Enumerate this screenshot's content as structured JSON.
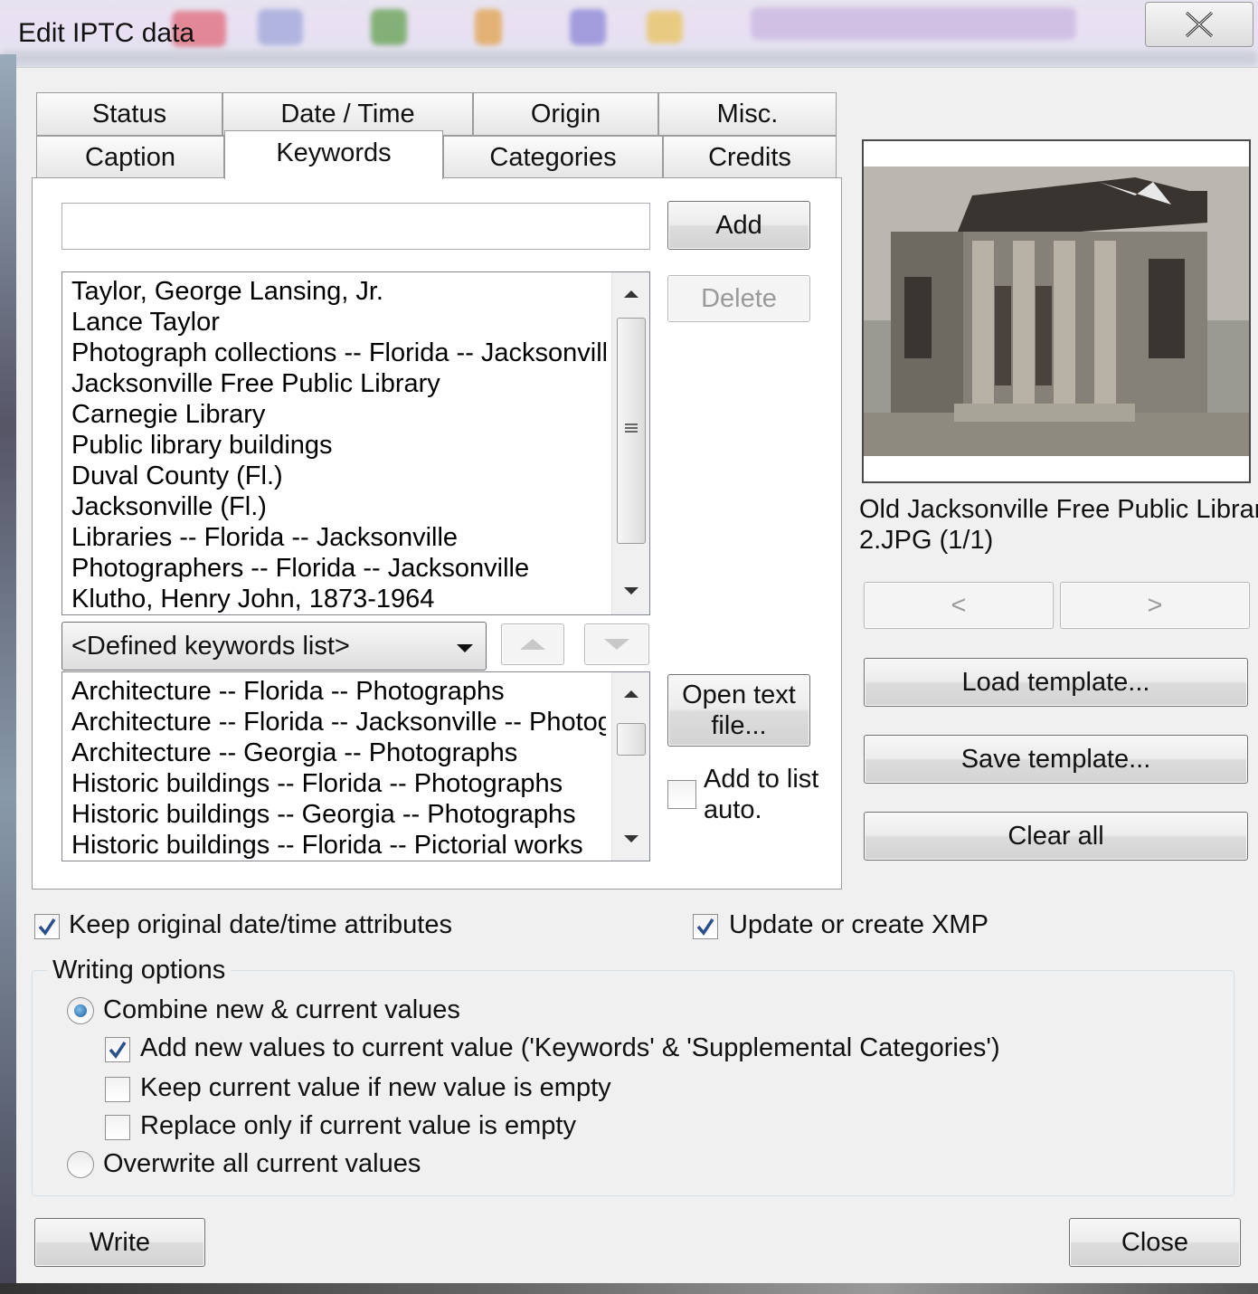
{
  "window": {
    "title": "Edit IPTC data",
    "background_path_hint": "Z:\\Lance Taylor\\Libraries\\"
  },
  "tabs": {
    "row1": [
      "Status",
      "Date / Time",
      "Origin",
      "Misc."
    ],
    "row2": [
      "Caption",
      "Keywords",
      "Categories",
      "Credits"
    ],
    "active": "Keywords"
  },
  "keywords": {
    "input_value": "",
    "add_label": "Add",
    "delete_label": "Delete",
    "items": [
      "Taylor, George Lansing, Jr.",
      "Lance Taylor",
      "Photograph collections -- Florida -- Jacksonville",
      "Jacksonville Free Public Library",
      "Carnegie Library",
      "Public library buildings",
      "Duval County (Fl.)",
      "Jacksonville (Fl.)",
      "Libraries -- Florida -- Jacksonville",
      "Photographers -- Florida -- Jacksonville",
      "Klutho, Henry John, 1873-1964"
    ],
    "defined_list_selected": "<Defined keywords list>",
    "defined_items": [
      "Architecture -- Florida -- Photographs",
      "Architecture -- Florida -- Jacksonville -- Photographs",
      "Architecture -- Georgia -- Photographs",
      "Historic buildings -- Florida -- Photographs",
      "Historic buildings -- Georgia -- Photographs",
      "Historic buildings -- Florida -- Pictorial works"
    ],
    "open_text_file_line1": "Open text",
    "open_text_file_line2": "file...",
    "add_to_list_line1": "Add to list",
    "add_to_list_line2": "auto.",
    "add_to_list_checked": false
  },
  "preview": {
    "filename_line1": "Old Jacksonville Free Public Library",
    "filename_line2": "2.JPG (1/1)",
    "prev_label": "<",
    "next_label": ">",
    "load_template": "Load template...",
    "save_template": "Save template...",
    "clear_all": "Clear all"
  },
  "options": {
    "keep_original_datetime": "Keep original date/time attributes",
    "keep_original_datetime_checked": true,
    "update_xmp": "Update or create XMP",
    "update_xmp_checked": true
  },
  "writing_options": {
    "title": "Writing options",
    "combine": "Combine new & current values",
    "combine_selected": true,
    "add_new_values": "Add new values to current value ('Keywords' & 'Supplemental Categories')",
    "add_new_values_checked": true,
    "keep_current": "Keep current value if new value is empty",
    "keep_current_checked": false,
    "replace_only": "Replace only if current value is empty",
    "replace_only_checked": false,
    "overwrite": "Overwrite all current values",
    "overwrite_selected": false
  },
  "footer": {
    "write": "Write",
    "close": "Close"
  }
}
